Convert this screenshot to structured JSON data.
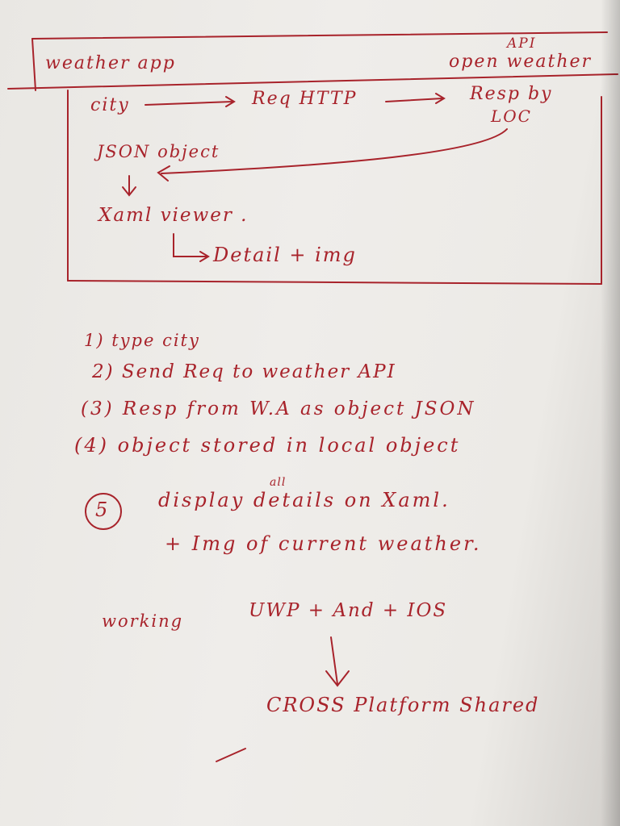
{
  "diagram": {
    "title": "weather app",
    "api_label": "API",
    "api_name": "open weather",
    "flow": {
      "city": "city",
      "req": "Req HTTP",
      "resp": "Resp by",
      "loc": "LOC",
      "json": "JSON object",
      "xaml": "Xaml viewer .",
      "detail": "Detail + img"
    }
  },
  "steps": [
    "1) type city",
    "2) Send Req to weather API",
    "(3) Resp from W.A as object JSON",
    "(4) object stored in local object",
    "5",
    "display details on Xaml.",
    "all",
    "+ Img of current weather."
  ],
  "footer": {
    "working": "working",
    "platforms": "UWP + And + IOS",
    "cross": "CROSS Platform Shared"
  }
}
